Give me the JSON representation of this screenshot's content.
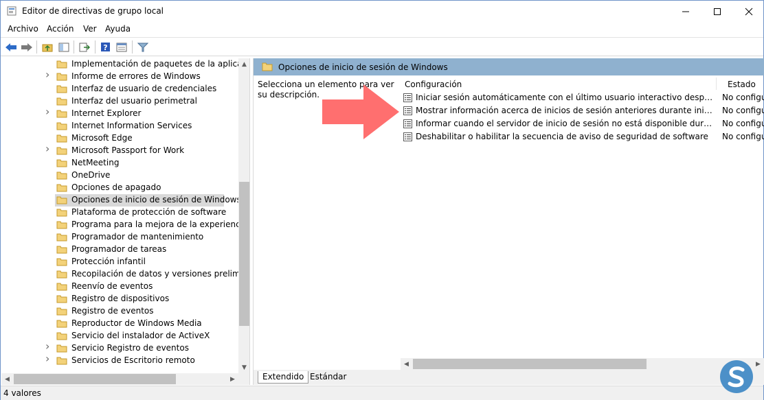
{
  "window": {
    "title": "Editor de directivas de grupo local"
  },
  "controls": {
    "minimize": "—",
    "maximize": "☐",
    "close": "✕"
  },
  "menu": [
    "Archivo",
    "Acción",
    "Ver",
    "Ayuda"
  ],
  "toolbar": {
    "buttons": [
      "back-icon",
      "forward-icon",
      "up-folder-icon",
      "show-hide-tree-icon",
      "export-list-icon",
      "help-icon",
      "properties-icon",
      "filter-icon"
    ]
  },
  "tree": {
    "items": [
      {
        "label": "Implementación de paquetes de la aplicación",
        "expandable": false
      },
      {
        "label": "Informe de errores de Windows",
        "expandable": true
      },
      {
        "label": "Interfaz de usuario de credenciales",
        "expandable": false
      },
      {
        "label": "Interfaz del usuario perimetral",
        "expandable": false
      },
      {
        "label": "Internet Explorer",
        "expandable": true
      },
      {
        "label": "Internet Information Services",
        "expandable": false
      },
      {
        "label": "Microsoft Edge",
        "expandable": false
      },
      {
        "label": "Microsoft Passport for Work",
        "expandable": true
      },
      {
        "label": "NetMeeting",
        "expandable": false
      },
      {
        "label": "OneDrive",
        "expandable": false
      },
      {
        "label": "Opciones de apagado",
        "expandable": false
      },
      {
        "label": "Opciones de inicio de sesión de Windows",
        "expandable": false,
        "selected": true
      },
      {
        "label": "Plataforma de protección de software",
        "expandable": false
      },
      {
        "label": "Programa para la mejora de la experiencia del",
        "expandable": false
      },
      {
        "label": "Programador de mantenimiento",
        "expandable": false
      },
      {
        "label": "Programador de tareas",
        "expandable": false
      },
      {
        "label": "Protección infantil",
        "expandable": false
      },
      {
        "label": "Recopilación de datos y versiones preliminares",
        "expandable": false
      },
      {
        "label": "Reenvío de eventos",
        "expandable": false
      },
      {
        "label": "Registro de dispositivos",
        "expandable": false
      },
      {
        "label": "Registro de eventos",
        "expandable": false
      },
      {
        "label": "Reproductor de Windows Media",
        "expandable": false
      },
      {
        "label": "Servicio del instalador de ActiveX",
        "expandable": false
      },
      {
        "label": "Servicio Registro de eventos",
        "expandable": true
      },
      {
        "label": "Servicios de Escritorio remoto",
        "expandable": true
      }
    ]
  },
  "right": {
    "header_title": "Opciones de inicio de sesión de Windows",
    "description": "Selecciona un elemento para ver su descripción.",
    "columns": {
      "setting": "Configuración",
      "state": "Estado"
    },
    "settings": [
      {
        "name": "Iniciar sesión automáticamente con el último usuario interactivo después de un r...",
        "state": "No configu"
      },
      {
        "name": "Mostrar información acerca de inicios de sesión anteriores durante inicio de sesió...",
        "state": "No configu"
      },
      {
        "name": "Informar cuando el servidor de inicio de sesión no está disponible durante el inici...",
        "state": "No configu"
      },
      {
        "name": "Deshabilitar o habilitar la secuencia de aviso de seguridad de software",
        "state": "No configu"
      }
    ],
    "tabs": [
      "Extendido",
      "Estándar"
    ]
  },
  "status": {
    "text": "4 valores"
  },
  "colors": {
    "header": "#8fb1cf",
    "arrow": "#ff6f6f",
    "selection": "#d9d9d9"
  }
}
